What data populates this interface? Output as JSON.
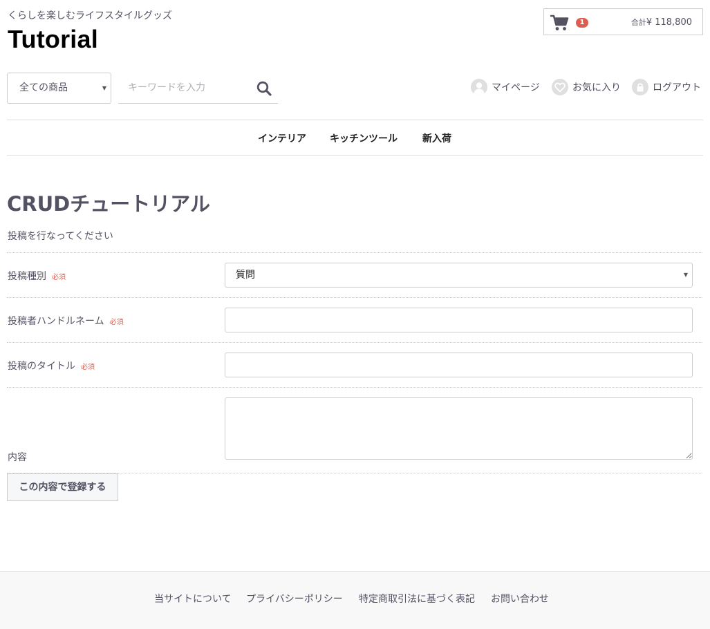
{
  "header": {
    "tagline": "くらしを楽しむライフスタイルグッズ",
    "logo": "Tutorial",
    "cart": {
      "count": "1",
      "total_label": "合計",
      "total_value": "¥ 118,800",
      "icon": "cart-icon"
    },
    "search": {
      "category_selected": "全ての商品",
      "placeholder": "キーワードを入力",
      "icon": "search-icon"
    },
    "user_nav": {
      "mypage": "マイページ",
      "favorites": "お気に入り",
      "logout": "ログアウト"
    }
  },
  "global_nav": {
    "items": [
      "インテリア",
      "キッチンツール",
      "新入荷"
    ]
  },
  "main": {
    "title": "CRUDチュートリアル",
    "lead": "投稿を行なってください",
    "required_label": "必須",
    "fields": {
      "type": {
        "label": "投稿種別",
        "selected": "質問"
      },
      "handle": {
        "label": "投稿者ハンドルネーム",
        "value": ""
      },
      "post_title": {
        "label": "投稿のタイトル",
        "value": ""
      },
      "content": {
        "label": "内容",
        "value": ""
      }
    },
    "submit_label": "この内容で登録する"
  },
  "footer": {
    "links": [
      "当サイトについて",
      "プライバシーポリシー",
      "特定商取引法に基づく表記",
      "お問い合わせ"
    ]
  },
  "colors": {
    "text": "#525263",
    "required": "#de5d50",
    "badge": "#de5d50",
    "border": "#cccccc",
    "footer_bg": "#f8f8f8"
  }
}
